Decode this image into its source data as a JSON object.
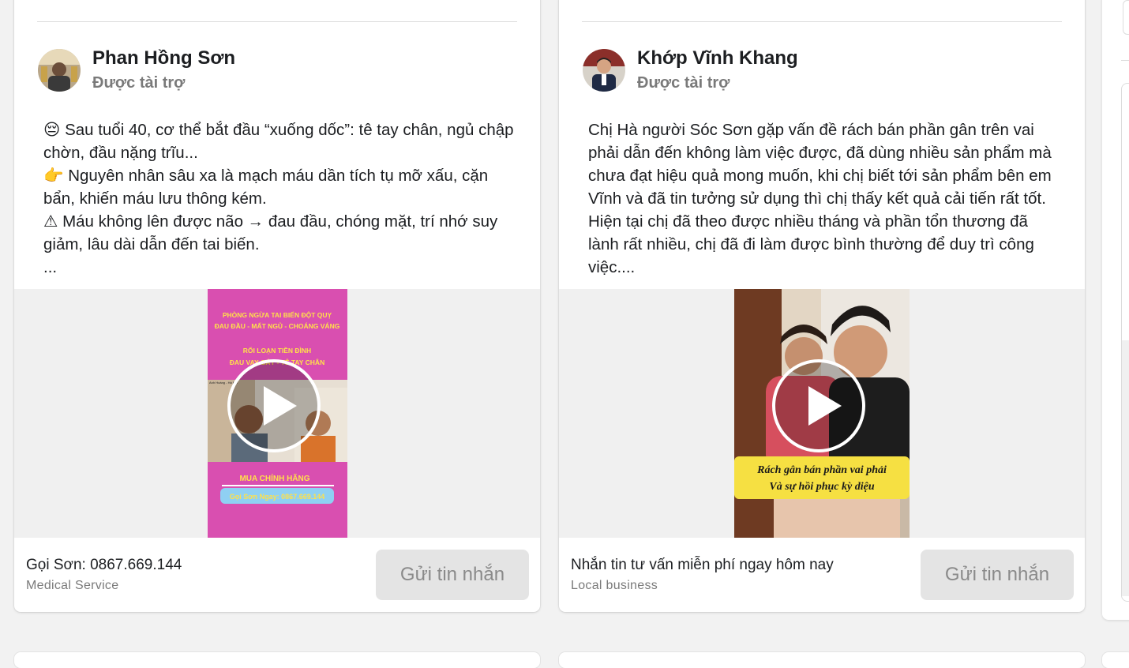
{
  "ads": [
    {
      "advertiser": "Phan Hồng Sơn",
      "sponsored": "Được tài trợ",
      "body": "😔 Sau tuổi 40, cơ thể bắt đầu “xuống dốc”: tê tay chân, ngủ chập chờn, đầu nặng trĩu...\n👉 Nguyên nhân sâu xa là mạch máu dần tích tụ mỡ xấu, cặn bẩn, khiến máu lưu thông kém.\n⚠ Máu không lên được não → đau đầu, chóng mặt, trí nhớ suy giảm, lâu dài dẫn đến tai biến.\n...",
      "video_text": {
        "line1": "PHÒNG NGỪA TAI BIẾN ĐỘT QUỴ",
        "line2": "ĐAU ĐẦU - MẤT NGỦ - CHOÁNG VÁNG",
        "line3": "RỐI LOẠN TIỀN ĐÌNH",
        "line4": "ĐAU VAY GÁY - TÊ TAY CHÂN",
        "caption": "Anh Hoàng - Hà Nội",
        "buy": "MUA CHÍNH HÃNG",
        "phone": "Gọi Sơn Ngay: 0867.669.144"
      },
      "cta_title": "Gọi Sơn: 0867.669.144",
      "cta_subtitle": "Medical Service",
      "button_label": "Gửi tin nhắn"
    },
    {
      "advertiser": "Khớp Vĩnh Khang",
      "sponsored": "Được tài trợ",
      "body": "Chị Hà người Sóc Sơn gặp vấn đề rách bán phần gân trên vai phải dẫn đến không làm việc được, đã dùng nhiều sản phẩm mà chưa đạt hiệu quả mong muốn, khi chị biết tới sản phẩm bên em Vĩnh và đã tin tưởng sử dụng thì chị thấy kết quả cải tiến rất tốt. Hiện tại chị đã theo được nhiều tháng và phần tổn thương đã lành rất nhiều, chị đã đi làm được bình thường để duy trì công việc....",
      "video_text": {
        "line1": "Rách gân bán phần vai phải",
        "line2": "Và sự hồi phục kỳ diệu"
      },
      "cta_title": "Nhắn tin tư vấn miễn phí ngay hôm nay",
      "cta_subtitle": "Local business",
      "button_label": "Gửi tin nhắn"
    }
  ],
  "icons": {
    "play": "play-icon"
  },
  "colors": {
    "page_bg": "#f2f2f2",
    "button_bg": "#e4e4e4",
    "button_text": "#8a8a8a",
    "video1_bg": "#d94fb0",
    "video2_banner": "#f6e042"
  }
}
